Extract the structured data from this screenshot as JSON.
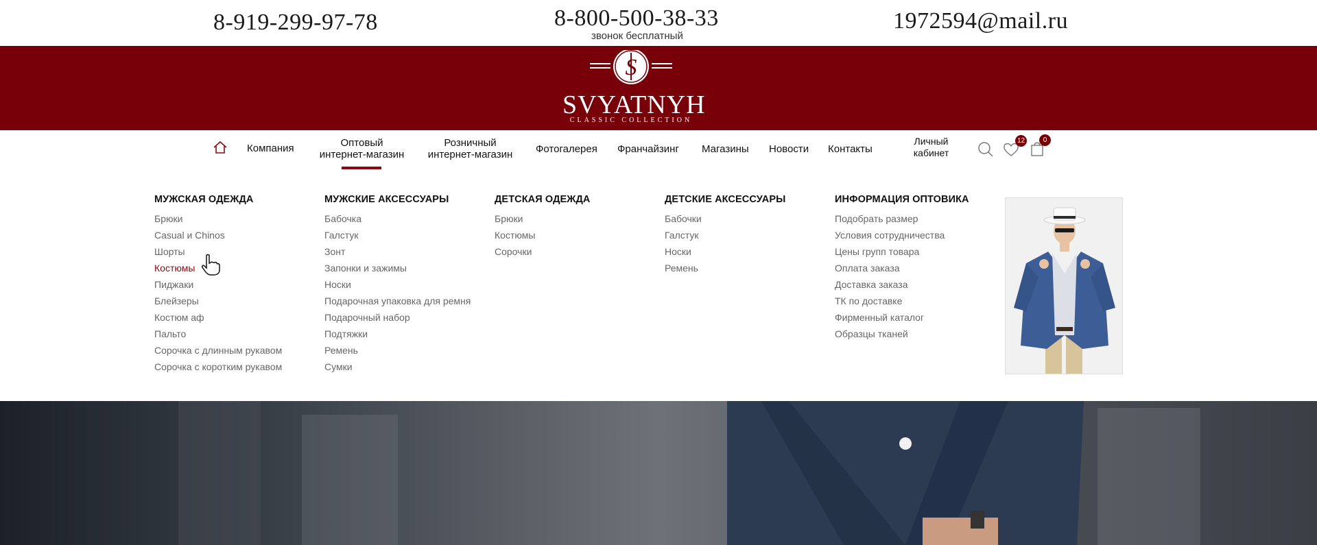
{
  "contacts": {
    "phone_left": "8-919-299-97-78",
    "phone_center": "8-800-500-38-33",
    "phone_center_note": "звонок бесплатный",
    "email": "1972594@mail.ru"
  },
  "brand": {
    "name": "SVYATNYH",
    "tagline": "CLASSIC COLLECTION",
    "color": "#780008"
  },
  "nav": {
    "company": "Компания",
    "wholesale_line1": "Оптовый",
    "wholesale_line2": "интернет-магазин",
    "retail_line1": "Розничный",
    "retail_line2": "интернет-магазин",
    "gallery": "Фотогалерея",
    "franchise": "Франчайзинг",
    "stores": "Магазины",
    "news": "Новости",
    "contacts": "Контакты",
    "account_line1": "Личный",
    "account_line2": "кабинет",
    "wishlist_count": "12",
    "cart_count": "0"
  },
  "menu": {
    "mens_clothing": {
      "title": "МУЖСКАЯ ОДЕЖДА",
      "items": [
        "Брюки",
        "Casual и Chinos",
        "Шорты",
        "Костюмы",
        "Пиджаки",
        "Блейзеры",
        "Костюм аф",
        "Пальто",
        "Сорочка с длинным рукавом",
        "Сорочка с коротким рукавом"
      ]
    },
    "mens_accessories": {
      "title": "МУЖСКИЕ АКСЕССУАРЫ",
      "items": [
        "Бабочка",
        "Галстук",
        "Зонт",
        "Запонки и зажимы",
        "Носки",
        "Подарочная упаковка для ремня",
        "Подарочный набор",
        "Подтяжки",
        "Ремень",
        "Сумки"
      ]
    },
    "kids_clothing": {
      "title": "ДЕТСКАЯ ОДЕЖДА",
      "items": [
        "Брюки",
        "Костюмы",
        "Сорочки"
      ]
    },
    "kids_accessories": {
      "title": "ДЕТСКИЕ АКСЕССУАРЫ",
      "items": [
        "Бабочки",
        "Галстук",
        "Носки",
        "Ремень"
      ]
    },
    "wholesale_info": {
      "title": "ИНФОРМАЦИЯ ОПТОВИКА",
      "items": [
        "Подобрать размер",
        "Условия сотрудничества",
        "Цены групп товара",
        "Оплата заказа",
        "Доставка заказа",
        "ТК по доставке",
        "Фирменный каталог",
        "Образцы тканей"
      ]
    }
  }
}
